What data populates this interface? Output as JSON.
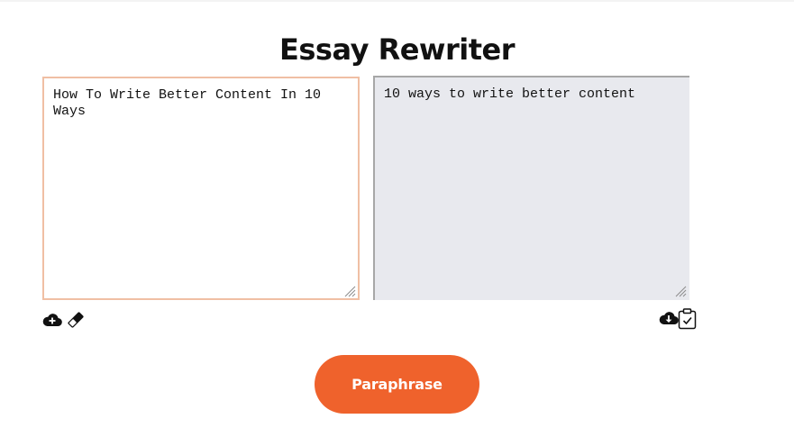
{
  "page": {
    "title": "Essay Rewriter"
  },
  "input_panel": {
    "value": "How To Write Better Content In 10 Ways",
    "upload_icon": "cloud-upload-icon",
    "clear_icon": "eraser-icon"
  },
  "output_panel": {
    "value": "10 ways to write better content",
    "download_icon": "cloud-download-icon",
    "copy_icon": "clipboard-check-icon"
  },
  "actions": {
    "paraphrase_label": "Paraphrase"
  },
  "colors": {
    "accent": "#ef622c",
    "input_border": "#f0bfa4",
    "output_background": "#e8e9ee"
  }
}
